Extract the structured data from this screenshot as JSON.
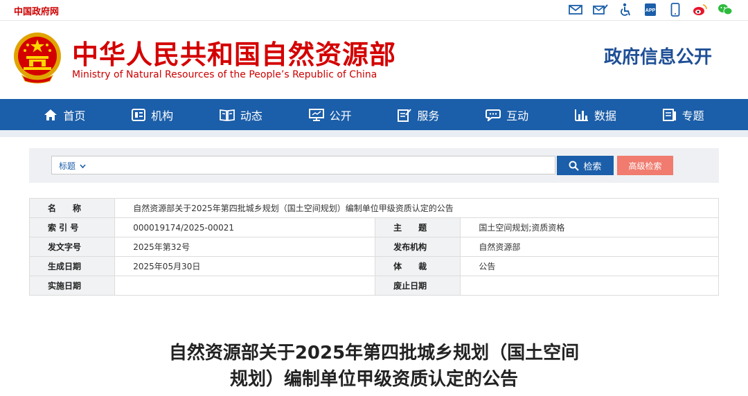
{
  "topbar": {
    "gov_link": "中国政府网",
    "icons": [
      "mail-icon",
      "mail-edit-icon",
      "accessibility-icon",
      "app-icon",
      "mobile-icon",
      "weibo-icon",
      "wechat-icon"
    ],
    "app_label": "APP"
  },
  "header": {
    "ministry_cn": "中华人民共和国自然资源部",
    "ministry_en": "Ministry of Natural Resources of the People’s Republic of China",
    "gov_info": "政府信息公开"
  },
  "nav": {
    "items": [
      {
        "label": "首页",
        "icon": "home-icon"
      },
      {
        "label": "机构",
        "icon": "org-icon"
      },
      {
        "label": "动态",
        "icon": "book-icon"
      },
      {
        "label": "公开",
        "icon": "monitor-icon"
      },
      {
        "label": "服务",
        "icon": "edit-icon"
      },
      {
        "label": "互动",
        "icon": "chat-icon"
      },
      {
        "label": "数据",
        "icon": "bar-chart-icon"
      },
      {
        "label": "专题",
        "icon": "topic-icon"
      }
    ]
  },
  "search": {
    "select_value": "标题",
    "input_value": "",
    "search_label": "检索",
    "advanced_label": "高级检索"
  },
  "meta": {
    "name_key": "名　　称",
    "name_value": "自然资源部关于2025年第四批城乡规划（国土空间规划）编制单位甲级资质认定的公告",
    "index_key": "索 引 号",
    "index_value": "000019174/2025-00021",
    "subject_key": "主　　题",
    "subject_value": "国土空间规划;资质资格",
    "docno_key": "发文字号",
    "docno_value": "2025年第32号",
    "issuer_key": "发布机构",
    "issuer_value": "自然资源部",
    "date_key": "生成日期",
    "date_value": "2025年05月30日",
    "genre_key": "体　　裁",
    "genre_value": "公告",
    "impl_key": "实施日期",
    "impl_value": "",
    "abolish_key": "废止日期",
    "abolish_value": ""
  },
  "document": {
    "title_line1": "自然资源部关于2025年第四批城乡规划（国土空间",
    "title_line2": "规划）编制单位甲级资质认定的公告"
  },
  "colors": {
    "brand_red": "#d40000",
    "nav_blue": "#1b5ea9",
    "advanced_btn": "#f07b6e"
  }
}
